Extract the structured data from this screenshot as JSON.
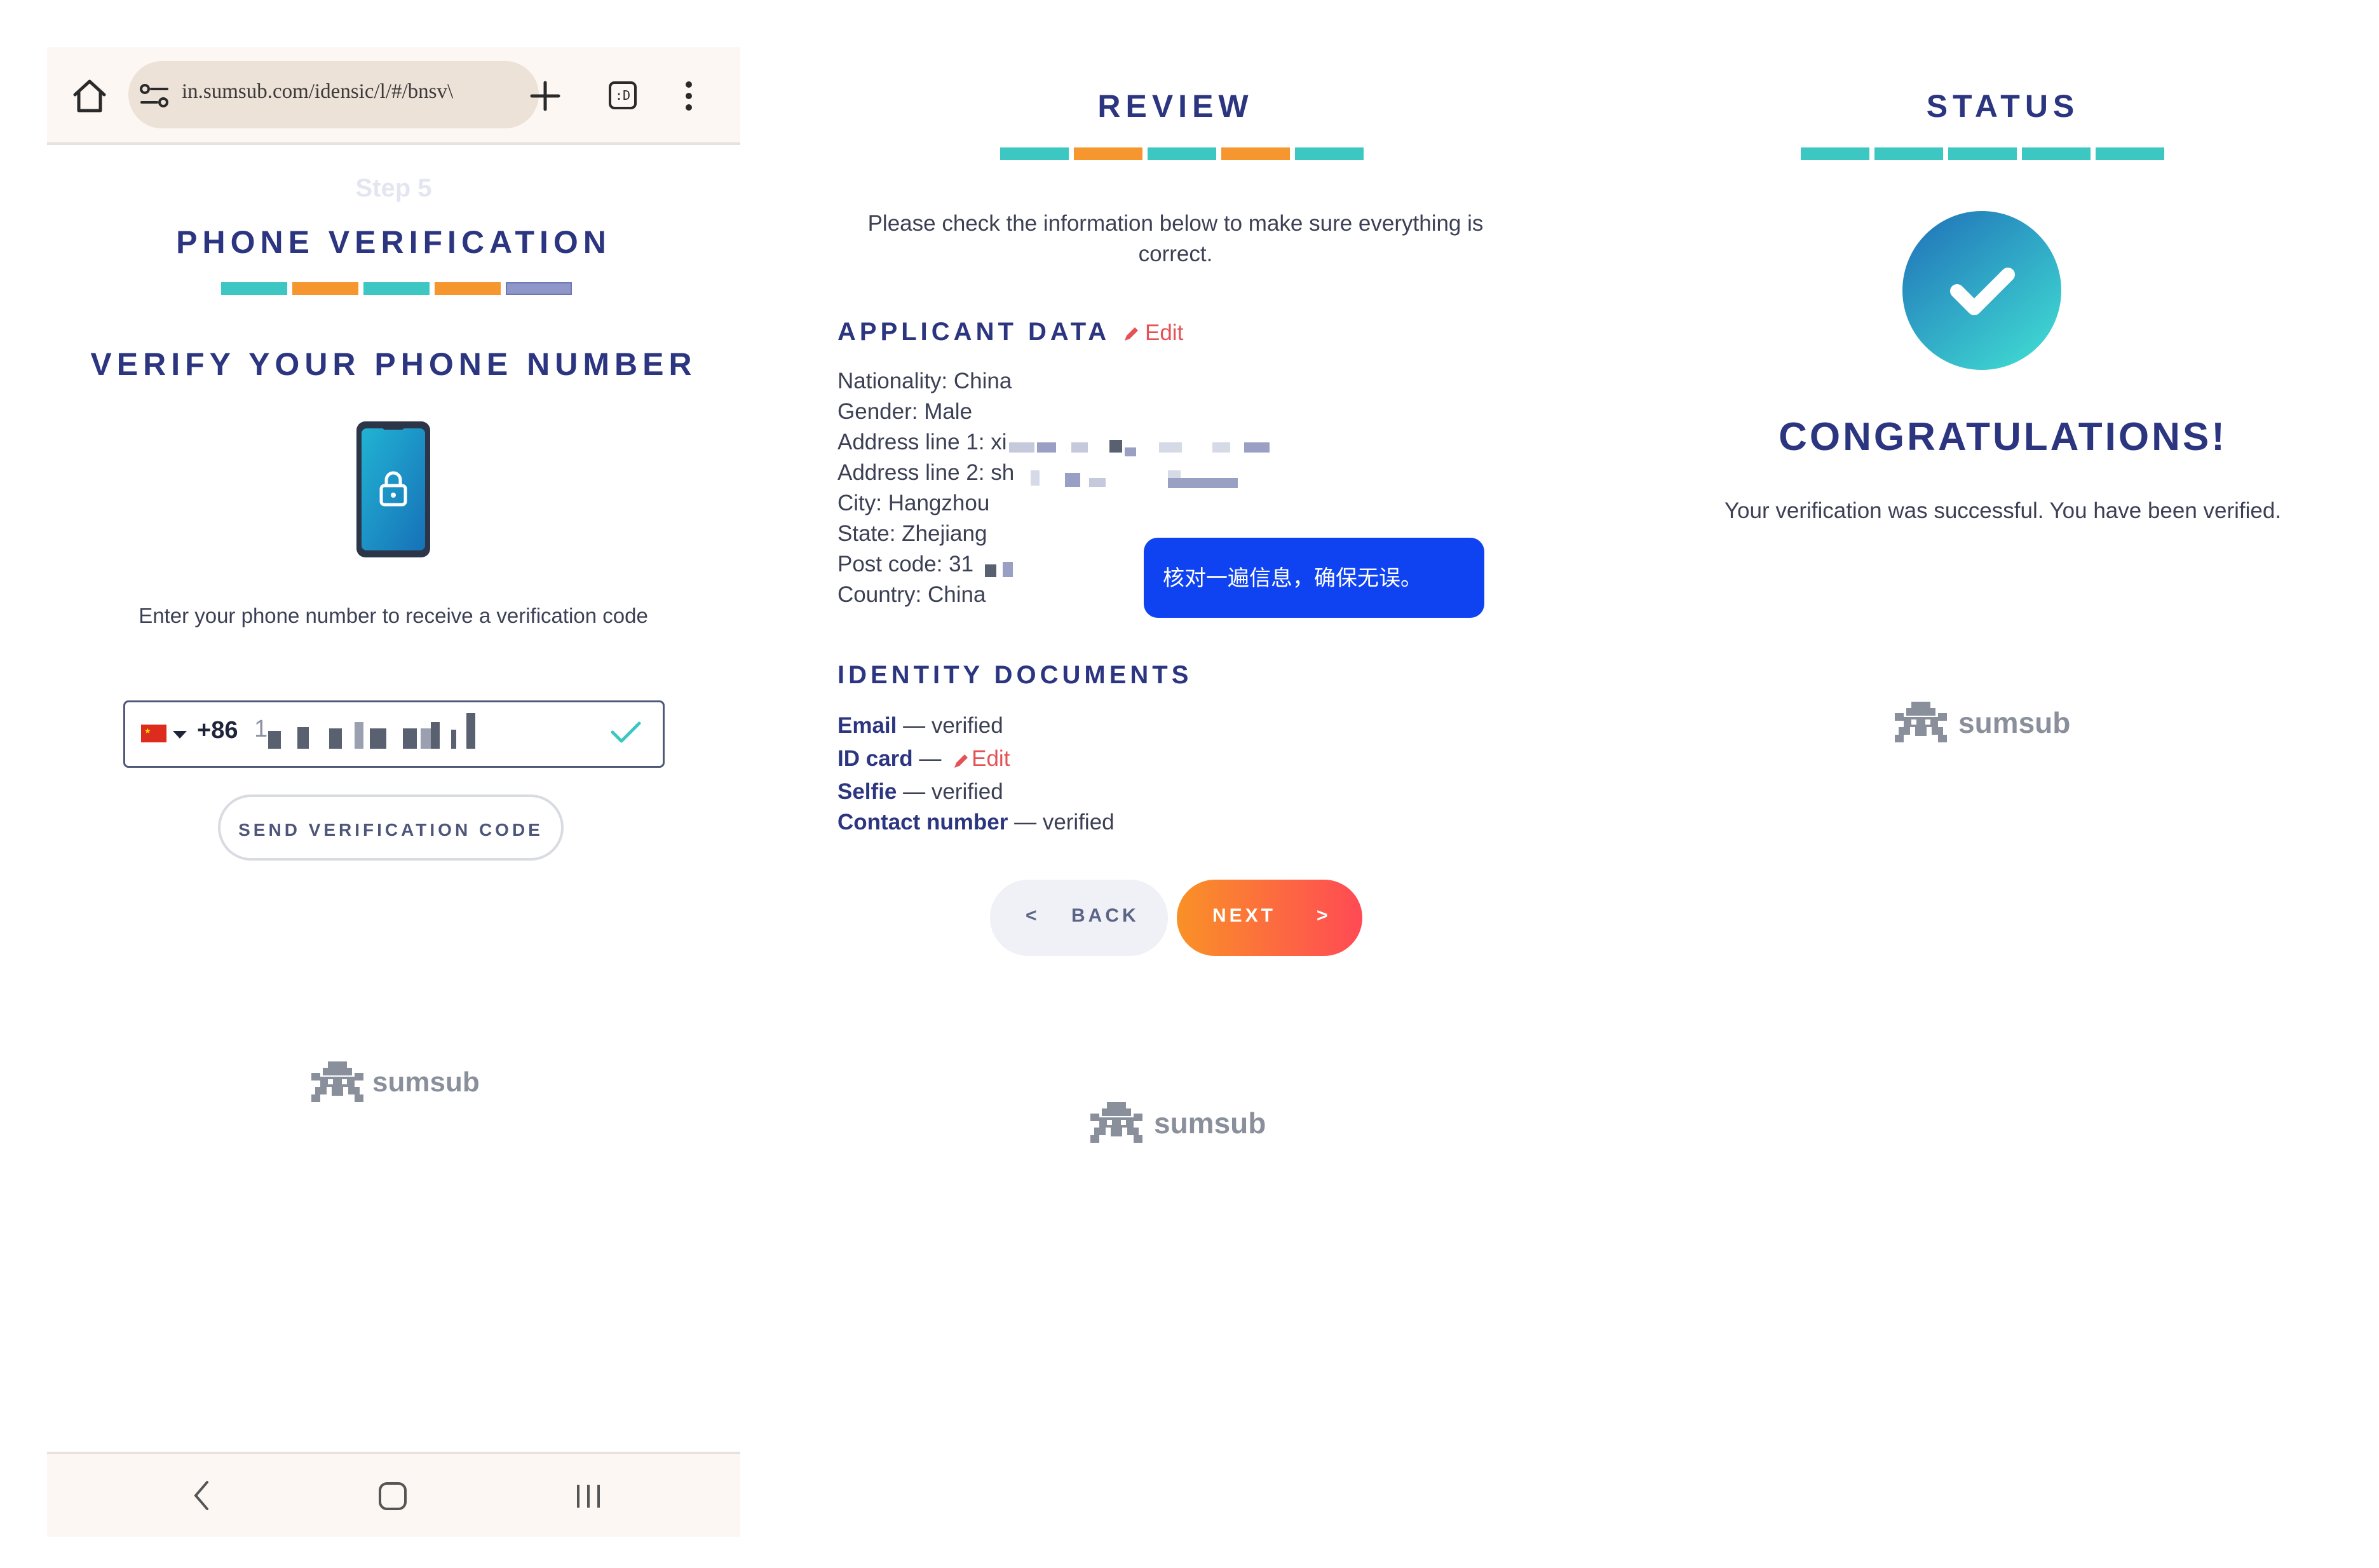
{
  "browser": {
    "url": "in.sumsub.com/idensic/l/#/bnsv\\",
    "tab_count_label": ":D"
  },
  "phone_step": {
    "step_label": "Step 5",
    "title": "PHONE VERIFICATION",
    "subtitle": "VERIFY YOUR PHONE NUMBER",
    "instructions": "Enter your phone number to receive a verification code",
    "country_code": "+86",
    "phone_number_partial": "1",
    "send_button": "SEND VERIFICATION CODE",
    "brand": "sumsub",
    "progress_colors": [
      "#3cc7c2",
      "#f6962e",
      "#3cc7c2",
      "#f6962e",
      "#8f96c8"
    ]
  },
  "review_step": {
    "title": "REVIEW",
    "intro": "Please check the information below to make sure everything is correct.",
    "applicant_heading": "APPLICANT DATA",
    "edit_label": "Edit",
    "applicant_fields": [
      "Nationality: China",
      "Gender: Male",
      "Address line 1: xi",
      "Address line 2: sh",
      "City: Hangzhou",
      "State: Zhejiang",
      "Post code: 31",
      "Country: China"
    ],
    "tooltip": "核对一遍信息，确保无误。",
    "documents_heading": "IDENTITY DOCUMENTS",
    "documents": [
      {
        "name": "Email",
        "sep": " — ",
        "status": "verified"
      },
      {
        "name": "ID card",
        "sep": " — ",
        "status": "Edit"
      },
      {
        "name": "Selfie",
        "sep": " — ",
        "status": "verified"
      },
      {
        "name": "Contact number",
        "sep": " — ",
        "status": "verified"
      }
    ],
    "back_button": "BACK",
    "back_glyph": "<",
    "next_button": "NEXT",
    "next_glyph": ">",
    "brand": "sumsub",
    "progress_colors": [
      "#3cc7c2",
      "#f6962e",
      "#3cc7c2",
      "#f6962e",
      "#3cc7c2"
    ]
  },
  "status_step": {
    "title": "STATUS",
    "headline": "CONGRATULATIONS!",
    "message": "Your verification was successful. You have been verified.",
    "brand": "sumsub",
    "progress_colors": [
      "#3cc7c2",
      "#3cc7c2",
      "#3cc7c2",
      "#3cc7c2",
      "#3cc7c2"
    ]
  },
  "colors": {
    "navy": "#2c3580",
    "teal": "#3cc7c2",
    "orange": "#f6962e",
    "tooltip_blue": "#0f43f2",
    "edit_red": "#e55256"
  }
}
